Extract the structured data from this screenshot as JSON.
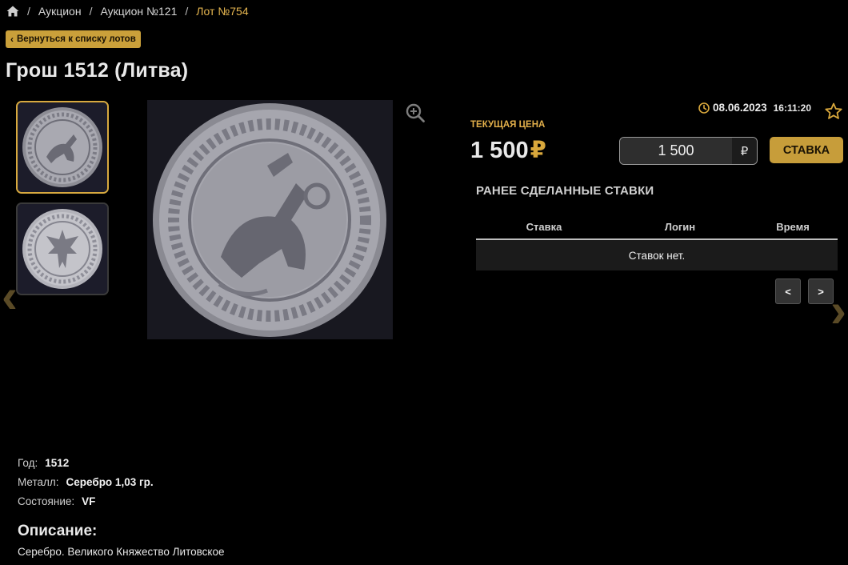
{
  "breadcrumb": {
    "items": [
      "Аукцион",
      "Аукцион №121",
      "Лот №754"
    ],
    "separator": "/"
  },
  "back_button": {
    "label": "Вернуться к списку лотов"
  },
  "lot": {
    "title": "Грош 1512 (Литва)"
  },
  "icons": {
    "home": "home-icon",
    "zoom": "zoom-in-icon",
    "clock": "clock-icon",
    "favorite": "star-icon",
    "back": "chevron-left-icon",
    "prev_image": "chevron-left-icon",
    "next_image": "chevron-right-icon"
  },
  "gallery": {
    "active_index": 0,
    "thumbnails": [
      {
        "name": "coin-obverse-thumbnail"
      },
      {
        "name": "coin-reverse-thumbnail"
      }
    ]
  },
  "auction": {
    "date": "08.06.2023",
    "time": "16:11:20",
    "price_label": "ТЕКУЩАЯ ЦЕНА",
    "price": "1 500",
    "currency": "₽",
    "bid_value": "1 500",
    "bid_button": "СТАВКА"
  },
  "history": {
    "title": "РАНЕЕ СДЕЛАННЫЕ СТАВКИ",
    "columns": [
      "Ставка",
      "Логин",
      "Время"
    ],
    "empty_text": "Ставок нет.",
    "prev_label": "<",
    "next_label": ">"
  },
  "specs": [
    {
      "label": "Год:",
      "value": "1512"
    },
    {
      "label": "Металл:",
      "value": "Серебро 1,03 гр."
    },
    {
      "label": "Состояние:",
      "value": "VF"
    }
  ],
  "description": {
    "title": "Описание:",
    "text": "Серебро. Великого Княжество Литовское"
  },
  "colors": {
    "accent": "#caa03a",
    "background": "#000000",
    "link_active": "#e5b54f"
  }
}
